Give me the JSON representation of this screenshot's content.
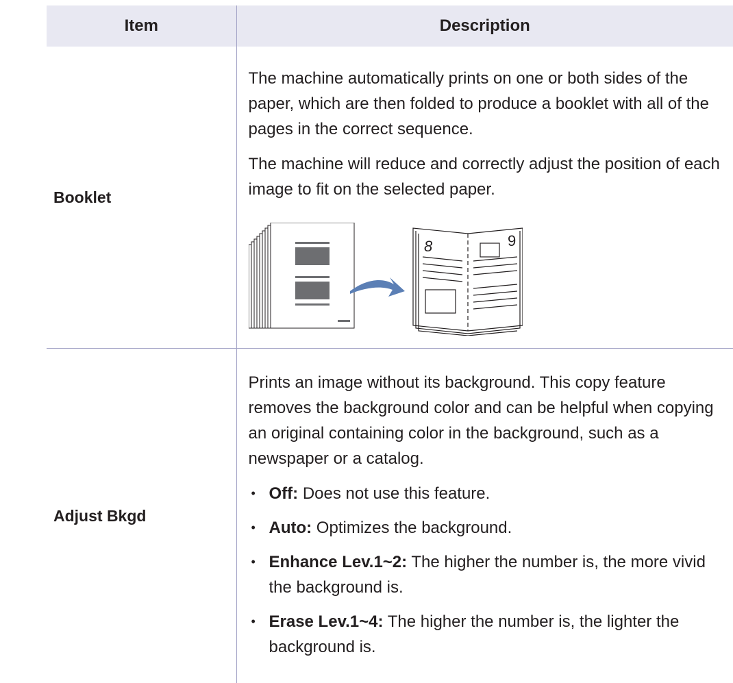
{
  "table": {
    "headers": {
      "item": "Item",
      "description": "Description"
    },
    "booklet": {
      "item": "Booklet",
      "paragraphs": [
        "The machine automatically prints on one or both sides of the paper, which are then folded to produce a booklet with all of the pages in the correct sequence.",
        "The machine will reduce and correctly adjust the position of each image to fit on the selected paper."
      ],
      "illustration": {
        "left_page_number": "8",
        "right_page_number": "9",
        "arrow_color": "#5b7fb5"
      }
    },
    "adjust_bkgd": {
      "item": "Adjust Bkgd",
      "intro": "Prints an image without its background. This copy feature removes the background color and can be helpful when copying an original containing color in the background, such as a newspaper or a catalog.",
      "options": [
        {
          "term": "Off:",
          "text": " Does not use this feature."
        },
        {
          "term": "Auto:",
          "text": " Optimizes the background."
        },
        {
          "term": "Enhance Lev.1~2:",
          "text": " The higher the number is, the more vivid the background is."
        },
        {
          "term": "Erase Lev.1~4:",
          "text": " The higher the number is, the lighter the background is."
        }
      ]
    }
  },
  "colors": {
    "rule": "#a3a3c6",
    "header_bg": "#e8e8f2",
    "text": "#231f20"
  }
}
